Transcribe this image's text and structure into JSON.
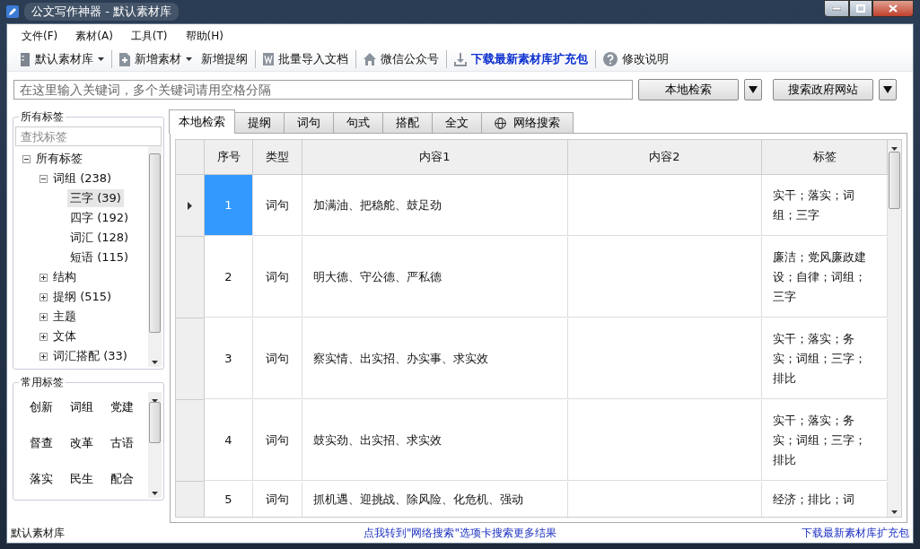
{
  "window": {
    "title": "公文写作神器 - 默认素材库"
  },
  "menu": [
    "文件(F)",
    "素材(A)",
    "工具(T)",
    "帮助(H)"
  ],
  "toolbar": [
    [
      {
        "kind": "dropdown",
        "label": "默认素材库"
      }
    ],
    [
      {
        "kind": "dropdown",
        "label": "新增素材"
      },
      {
        "kind": "button",
        "label": "新增提纲"
      }
    ],
    [
      {
        "kind": "button",
        "label": "批量导入文档"
      }
    ],
    [
      {
        "kind": "button",
        "label": "微信公众号"
      }
    ],
    [
      {
        "kind": "link",
        "label": "下载最新素材库扩充包"
      }
    ],
    [
      {
        "kind": "button",
        "label": "修改说明"
      }
    ]
  ],
  "search": {
    "placeholder": "在这里输入关键词，多个关键词请用空格分隔",
    "buttons": [
      "本地检索",
      "搜索政府网站"
    ]
  },
  "sidebar": {
    "title": "所有标签",
    "filter_placeholder": "查找标签",
    "tree": [
      {
        "label": "所有标签",
        "expanded": true,
        "selected": false,
        "children": [
          {
            "label": "词组",
            "count": "(238)",
            "expanded": true,
            "selected": false,
            "children": [
              {
                "label": "三字",
                "count": "(39)",
                "selected": true
              },
              {
                "label": "四字",
                "count": "(192)",
                "selected": false
              },
              {
                "label": "词汇",
                "count": "(128)",
                "selected": false
              },
              {
                "label": "短语",
                "count": "(115)",
                "selected": false
              }
            ]
          },
          {
            "label": "结构",
            "expanded": false,
            "selected": false
          },
          {
            "label": "提纲",
            "count": "(515)",
            "expanded": false,
            "selected": false
          },
          {
            "label": "主题",
            "expanded": false,
            "selected": false
          },
          {
            "label": "文体",
            "expanded": false,
            "selected": false
          },
          {
            "label": "词汇搭配",
            "count": "(33)",
            "expanded": false,
            "selected": false
          }
        ]
      }
    ]
  },
  "common_tags": {
    "title": "常用标签",
    "tags": [
      "创新",
      "词组",
      "党建",
      "督查",
      "改革",
      "古语",
      "落实",
      "民生",
      "配合"
    ]
  },
  "tabs": [
    {
      "label": "本地检索",
      "selected": true
    },
    {
      "label": "提纲",
      "selected": false
    },
    {
      "label": "词句",
      "selected": false
    },
    {
      "label": "句式",
      "selected": false
    },
    {
      "label": "搭配",
      "selected": false
    },
    {
      "label": "全文",
      "selected": false
    },
    {
      "label": "网络搜索",
      "selected": false
    }
  ],
  "table": {
    "columns": [
      "序号",
      "类型",
      "内容1",
      "内容2",
      "标签"
    ],
    "rows": [
      {
        "selected": true,
        "cells": [
          "1",
          "词句",
          "加满油、把稳舵、鼓足劲",
          "",
          "实干；落实；词组；三字"
        ]
      },
      {
        "selected": false,
        "cells": [
          "2",
          "词句",
          "明大德、守公德、严私德",
          "",
          "廉洁；党风廉政建设；自律；词组；三字"
        ]
      },
      {
        "selected": false,
        "cells": [
          "3",
          "词句",
          "察实情、出实招、办实事、求实效",
          "",
          "实干；落实；务实；词组；三字；排比"
        ]
      },
      {
        "selected": false,
        "cells": [
          "4",
          "词句",
          "鼓实劲、出实招、求实效",
          "",
          "实干；落实；务实；词组；三字；排比"
        ]
      },
      {
        "selected": false,
        "cells": [
          "5",
          "词句",
          "抓机遇、迎挑战、除风险、化危机、强动",
          "",
          "经济；排比；词"
        ]
      }
    ]
  },
  "status_bar": {
    "left": "默认素材库",
    "center": "点我转到\"网络搜索\"选项卡搜索更多结果",
    "right": "下载最新素材库扩充包"
  }
}
